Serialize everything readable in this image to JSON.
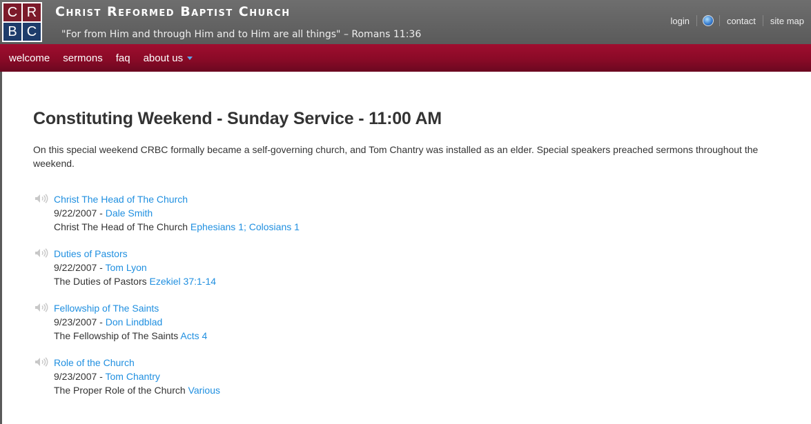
{
  "logo": {
    "letters": [
      "C",
      "R",
      "B",
      "C"
    ]
  },
  "site": {
    "title": "Christ Reformed Baptist Church",
    "tagline": "\"For from Him and through Him and to Him are all things\" – Romans 11:36"
  },
  "util_nav": {
    "login": "login",
    "contact": "contact",
    "site_map": "site map",
    "globe_icon": "globe-icon"
  },
  "nav": {
    "welcome": "welcome",
    "sermons": "sermons",
    "faq": "faq",
    "about_us": "about us"
  },
  "colors": {
    "nav_bg": "#8a0a27",
    "link": "#1f8fe0",
    "header_bg": "#5a5a5a"
  },
  "page": {
    "title": "Constituting Weekend - Sunday Service - 11:00 AM",
    "intro": "On this special weekend CRBC formally became a self-governing church, and Tom Chantry was installed as an elder. Special speakers preached sermons throughout the weekend."
  },
  "sermons": [
    {
      "title": "Christ The Head of The Church",
      "date": "9/22/2007",
      "speaker": "Dale Smith",
      "desc": "Christ The Head of The Church",
      "passage": "Ephesians 1; Colosians 1"
    },
    {
      "title": "Duties of Pastors",
      "date": "9/22/2007",
      "speaker": "Tom Lyon",
      "desc": "The Duties of Pastors",
      "passage": "Ezekiel 37:1-14"
    },
    {
      "title": "Fellowship of The Saints",
      "date": "9/23/2007",
      "speaker": "Don Lindblad",
      "desc": "The Fellowship of The Saints",
      "passage": "Acts 4"
    },
    {
      "title": "Role of the Church",
      "date": "9/23/2007",
      "speaker": "Tom Chantry",
      "desc": "The Proper Role of the Church",
      "passage": "Various"
    }
  ]
}
